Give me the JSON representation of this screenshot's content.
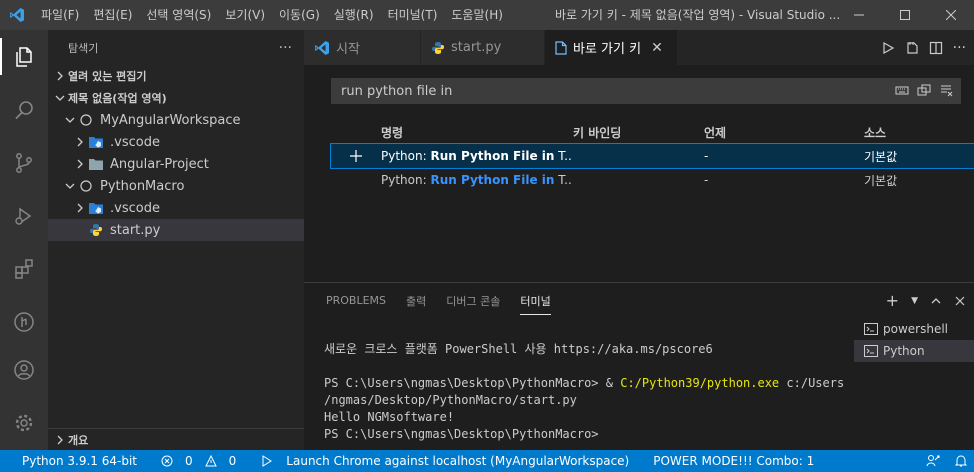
{
  "titlebar": {
    "menu": [
      "파일(F)",
      "편집(E)",
      "선택 영역(S)",
      "보기(V)",
      "이동(G)",
      "실행(R)",
      "터미널(T)",
      "도움말(H)"
    ],
    "title": "바로 가기 키 - 제목 없음(작업 영역) - Visual Studio ..."
  },
  "sidebar": {
    "title": "탐색기",
    "more": "···",
    "open_editors": "열려 있는 편집기",
    "workspace": "제목 없음(작업 영역)",
    "tree": [
      {
        "label": "MyAngularWorkspace"
      },
      {
        "label": ".vscode"
      },
      {
        "label": "Angular-Project"
      },
      {
        "label": "PythonMacro"
      },
      {
        "label": ".vscode"
      },
      {
        "label": "start.py"
      }
    ],
    "outline": "개요"
  },
  "tabs": [
    {
      "label": "시작"
    },
    {
      "label": "start.py"
    },
    {
      "label": "바로 가기 키"
    }
  ],
  "keybindings": {
    "search_value": "run python file in",
    "headers": {
      "plus": "",
      "command": "명령",
      "keybinding": "키 바인딩",
      "when": "언제",
      "source": "소스"
    },
    "rows": [
      {
        "prefix": "Python: ",
        "cmd": "Run Python File in",
        "suffix": " T...",
        "key": "",
        "when": "-",
        "source": "기본값"
      },
      {
        "prefix": "Python: ",
        "cmd": "Run Python File in",
        "suffix": " T...",
        "key": "",
        "when": "-",
        "source": "기본값"
      }
    ]
  },
  "panel": {
    "tabs": [
      "PROBLEMS",
      "출력",
      "디버그 콘솔",
      "터미널"
    ],
    "terminal": {
      "line1": "새로운 크로스 플랫폼 PowerShell 사용 https://aka.ms/pscore6",
      "line2_prompt": "PS C:\\Users\\ngmas\\Desktop\\PythonMacro> & ",
      "line2_exe": "C:/Python39/python.exe",
      "line2_rest": " c:/Users",
      "line3": "/ngmas/Desktop/PythonMacro/start.py",
      "line4": "Hello NGMsoftware!",
      "line5": "PS C:\\Users\\ngmas\\Desktop\\PythonMacro> "
    },
    "terminals": [
      {
        "label": "powershell"
      },
      {
        "label": "Python"
      }
    ]
  },
  "statusbar": {
    "python": "Python 3.9.1 64-bit",
    "errors": "0",
    "warnings": "0",
    "launch": "Launch Chrome against localhost (MyAngularWorkspace)",
    "power": "POWER MODE!!! Combo: 1"
  },
  "colors": {
    "accent": "#007acc",
    "selection_blue": "#3794ff",
    "terminal_yellow": "#e5e510"
  }
}
